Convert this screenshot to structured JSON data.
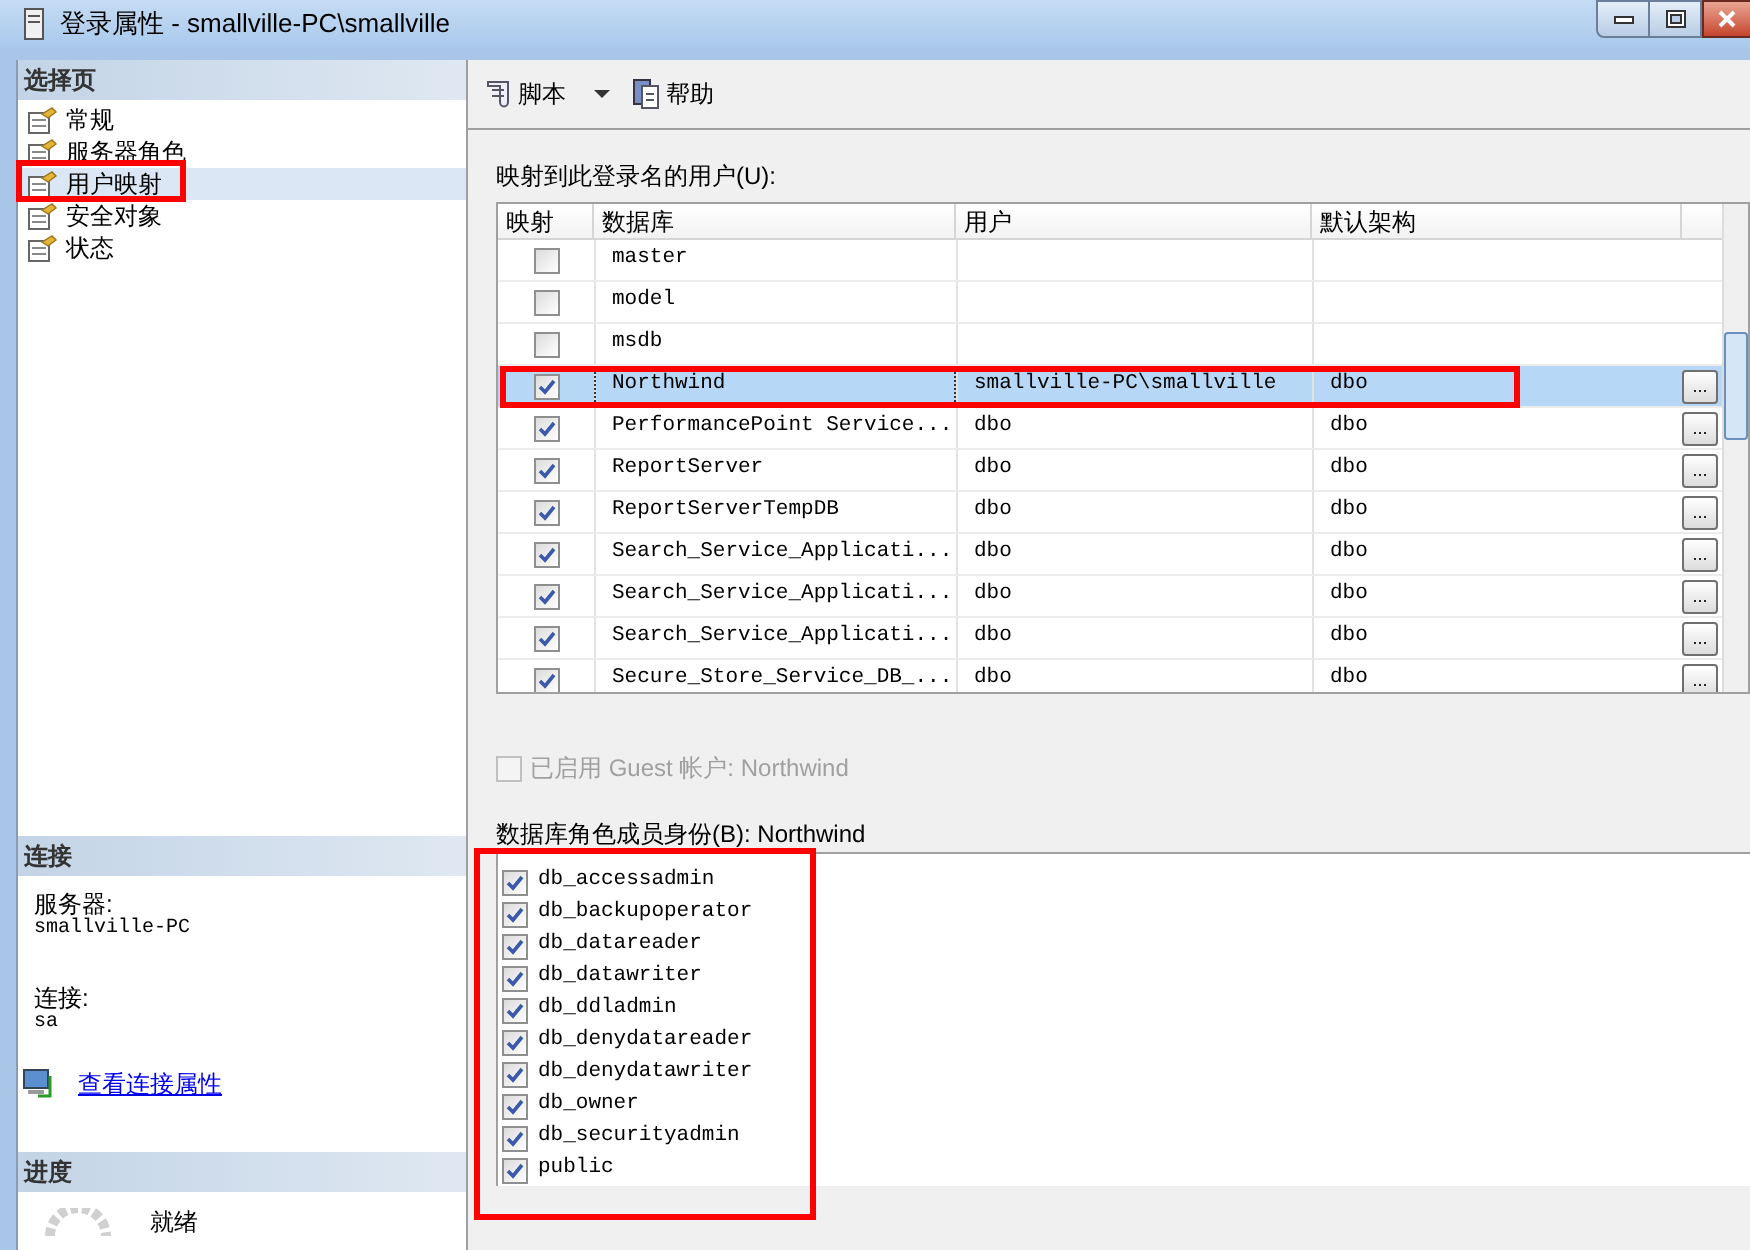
{
  "window": {
    "title": "登录属性 - smallville-PC\\smallville"
  },
  "sidebar": {
    "header": "选择页",
    "items": [
      {
        "label": "常规",
        "selected": false
      },
      {
        "label": "服务器角色",
        "selected": false
      },
      {
        "label": "用户映射",
        "selected": true
      },
      {
        "label": "安全对象",
        "selected": false
      },
      {
        "label": "状态",
        "selected": false
      }
    ]
  },
  "connection": {
    "header": "连接",
    "server_label": "服务器:",
    "server": "smallville-PC",
    "connection_label": "连接:",
    "connection": "sa",
    "link": "查看连接属性"
  },
  "progress": {
    "header": "进度",
    "status": "就绪"
  },
  "toolbar": {
    "script": "脚本",
    "help": "帮助"
  },
  "mapping": {
    "label": "映射到此登录名的用户(U):",
    "columns": [
      "映射",
      "数据库",
      "用户",
      "默认架构"
    ],
    "rows": [
      {
        "checked": false,
        "selected": false,
        "database": "master",
        "user": "",
        "schema": ""
      },
      {
        "checked": false,
        "selected": false,
        "database": "model",
        "user": "",
        "schema": ""
      },
      {
        "checked": false,
        "selected": false,
        "database": "msdb",
        "user": "",
        "schema": ""
      },
      {
        "checked": true,
        "selected": true,
        "database": "Northwind",
        "user": "smallville-PC\\smallville",
        "schema": "dbo",
        "button": "..."
      },
      {
        "checked": true,
        "selected": false,
        "database": "PerformancePoint Service...",
        "user": "dbo",
        "schema": "dbo",
        "button": "..."
      },
      {
        "checked": true,
        "selected": false,
        "database": "ReportServer",
        "user": "dbo",
        "schema": "dbo",
        "button": "..."
      },
      {
        "checked": true,
        "selected": false,
        "database": "ReportServerTempDB",
        "user": "dbo",
        "schema": "dbo",
        "button": "..."
      },
      {
        "checked": true,
        "selected": false,
        "database": "Search_Service_Applicati...",
        "user": "dbo",
        "schema": "dbo",
        "button": "..."
      },
      {
        "checked": true,
        "selected": false,
        "database": "Search_Service_Applicati...",
        "user": "dbo",
        "schema": "dbo",
        "button": "..."
      },
      {
        "checked": true,
        "selected": false,
        "database": "Search_Service_Applicati...",
        "user": "dbo",
        "schema": "dbo",
        "button": "..."
      },
      {
        "checked": true,
        "selected": false,
        "database": "Secure_Store_Service_DB_...",
        "user": "dbo",
        "schema": "dbo",
        "button": "..."
      }
    ]
  },
  "guest": {
    "label": "已启用 Guest 帐户: Northwind",
    "checked": false,
    "disabled": true
  },
  "roles": {
    "label": "数据库角色成员身份(B): Northwind",
    "items": [
      {
        "label": "db_accessadmin",
        "checked": true
      },
      {
        "label": "db_backupoperator",
        "checked": true
      },
      {
        "label": "db_datareader",
        "checked": true
      },
      {
        "label": "db_datawriter",
        "checked": true
      },
      {
        "label": "db_ddladmin",
        "checked": true
      },
      {
        "label": "db_denydatareader",
        "checked": true
      },
      {
        "label": "db_denydatawriter",
        "checked": true
      },
      {
        "label": "db_owner",
        "checked": true
      },
      {
        "label": "db_securityadmin",
        "checked": true
      },
      {
        "label": "public",
        "checked": true
      }
    ]
  }
}
